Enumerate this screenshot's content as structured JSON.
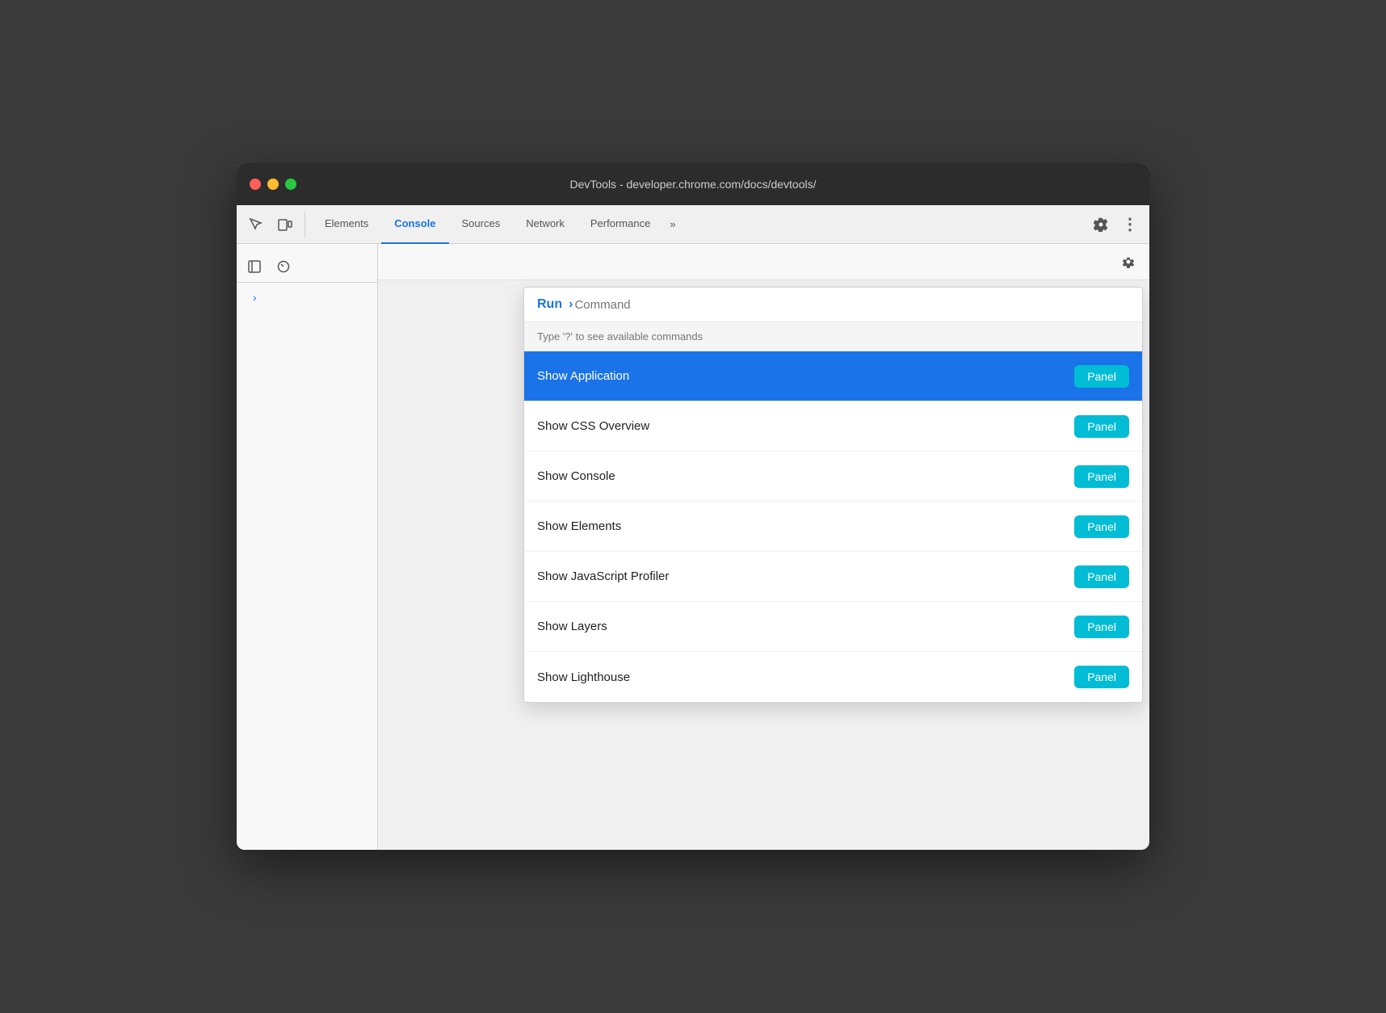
{
  "window": {
    "title": "DevTools - developer.chrome.com/docs/devtools/"
  },
  "trafficLights": {
    "close": "close",
    "minimize": "minimize",
    "maximize": "maximize"
  },
  "tabs": [
    {
      "id": "elements",
      "label": "Elements",
      "active": false
    },
    {
      "id": "console",
      "label": "Console",
      "active": true
    },
    {
      "id": "sources",
      "label": "Sources",
      "active": false
    },
    {
      "id": "network",
      "label": "Network",
      "active": false
    },
    {
      "id": "performance",
      "label": "Performance",
      "active": false
    }
  ],
  "tabMore": "»",
  "commandPalette": {
    "runLabel": "Run",
    "arrow": "⌥",
    "inputPlaceholder": "Command",
    "hint": "Type '?' to see available commands",
    "items": [
      {
        "id": "show-application",
        "label": "Show Application",
        "badge": "Panel",
        "highlighted": true
      },
      {
        "id": "show-css-overview",
        "label": "Show CSS Overview",
        "badge": "Panel",
        "highlighted": false
      },
      {
        "id": "show-console",
        "label": "Show Console",
        "badge": "Panel",
        "highlighted": false
      },
      {
        "id": "show-elements",
        "label": "Show Elements",
        "badge": "Panel",
        "highlighted": false
      },
      {
        "id": "show-js-profiler",
        "label": "Show JavaScript Profiler",
        "badge": "Panel",
        "highlighted": false
      },
      {
        "id": "show-layers",
        "label": "Show Layers",
        "badge": "Panel",
        "highlighted": false
      },
      {
        "id": "show-lighthouse",
        "label": "Show Lighthouse",
        "badge": "Panel",
        "highlighted": false
      }
    ]
  },
  "icons": {
    "inspect": "⬚",
    "device": "⧉",
    "more": "»",
    "gear": "⚙",
    "dots": "⋮",
    "togglePanel": "⊟",
    "console": "⊘",
    "chevronRight": "›"
  }
}
